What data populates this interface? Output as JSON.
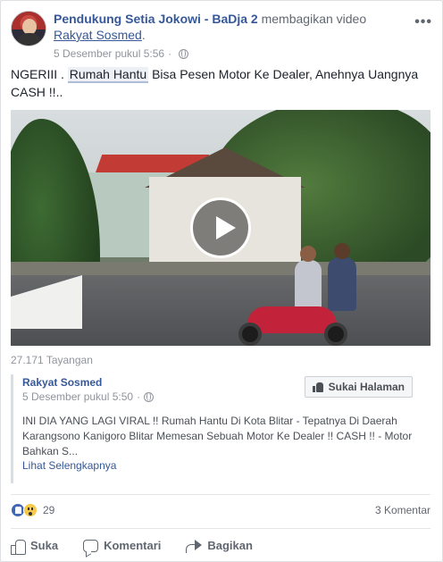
{
  "post": {
    "author": "Pendukung Setia Jokowi - BaDja 2",
    "action": "membagikan video",
    "shared_link": "Rakyat Sosmed",
    "shared_suffix": ".",
    "timestamp": "5 Desember pukul 5:56",
    "more_label": "•••",
    "text_prefix": "NGERIII . ",
    "text_tag": "Rumah Hantu",
    "text_suffix": " Bisa Pesen Motor Ke Dealer, Anehnya Uangnya CASH !!.."
  },
  "video": {
    "views": "27.171 Tayangan"
  },
  "source": {
    "name": "Rakyat Sosmed",
    "timestamp": "5 Desember pukul 5:50",
    "like_page_label": "Sukai Halaman",
    "description": "INI DIA YANG LAGI VIRAL !! Rumah Hantu Di Kota Blitar - Tepatnya Di Daerah Karangsono Kanigoro Blitar Memesan Sebuah Motor Ke Dealer !! CASH !! - Motor Bahkan S...",
    "see_more": "Lihat Selengkapnya"
  },
  "reactions": {
    "count": "29",
    "comments": "3 Komentar",
    "icons": [
      "like-reaction-icon",
      "wow-reaction-icon"
    ]
  },
  "actions": {
    "like": "Suka",
    "comment": "Komentari",
    "share": "Bagikan"
  },
  "colors": {
    "link": "#365899",
    "muted": "#90949c",
    "like_blue": "#4267b2"
  }
}
